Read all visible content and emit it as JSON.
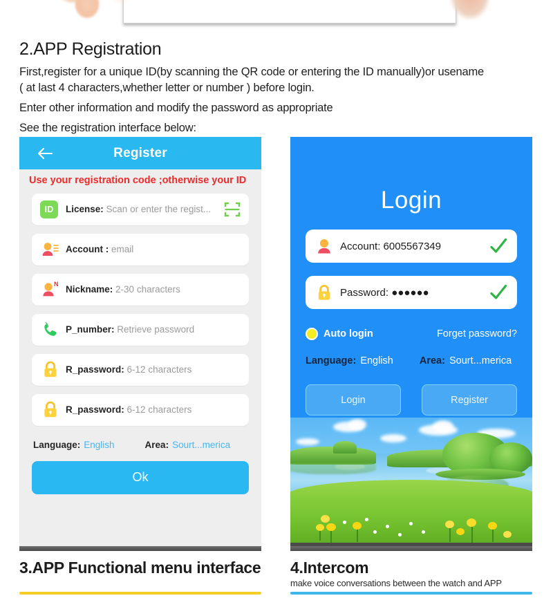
{
  "section": {
    "heading": "2.APP Registration",
    "paragraphs": [
      "First,register for a unique ID(by scanning the QR code or entering the ID manually)or usename",
      "( at last 4 characters,whether letter or number ) before login.",
      "Enter other information and modify the password as appropriate",
      "See the registration interface below:"
    ]
  },
  "register": {
    "back_icon": "back-arrow-icon",
    "title": "Register",
    "warning": "Use your registration code ;otherwise your ID",
    "fields": [
      {
        "icon": "id-badge-icon",
        "icon_text": "ID",
        "label": "License:",
        "value": "Scan or enter the regist...",
        "trailing_icon": "qr-scan-icon"
      },
      {
        "icon": "user-account-icon",
        "icon_text": "",
        "label": "Account :",
        "value": "email",
        "trailing_icon": ""
      },
      {
        "icon": "nickname-user-icon",
        "icon_text": "N",
        "label": "Nickname:",
        "value": "2-30 characters",
        "trailing_icon": ""
      },
      {
        "icon": "phone-icon",
        "icon_text": "",
        "label": "P_number:",
        "value": "Retrieve password",
        "trailing_icon": ""
      },
      {
        "icon": "lock-icon",
        "icon_text": "",
        "label": "R_password:",
        "value": "6-12 characters",
        "trailing_icon": ""
      },
      {
        "icon": "lock-icon",
        "icon_text": "",
        "label": "R_password:",
        "value": "6-12 characters",
        "trailing_icon": ""
      }
    ],
    "language_label": "Language:",
    "language_value": "English",
    "area_label": "Area:",
    "area_value": "Sourt...merica",
    "ok_button": "Ok"
  },
  "login": {
    "title": "Login",
    "fields": [
      {
        "icon": "user-account-icon",
        "label": "Account:",
        "value": "6005567349",
        "check_icon": "green-check-icon"
      },
      {
        "icon": "lock-icon",
        "label": "Password:",
        "value": "●●●●●●",
        "check_icon": "green-check-icon"
      }
    ],
    "auto_login_label": "Auto login",
    "forget_password": "Forget password?",
    "language_label": "Language:",
    "language_value": "English",
    "area_label": "Area:",
    "area_value": "Sourt...merica",
    "login_button": "Login",
    "register_button": "Register"
  },
  "bottom": {
    "left_heading": "3.APP Functional menu interface",
    "right_heading": "4.Intercom",
    "right_sub": "make voice conversations between the watch and APP"
  },
  "colors": {
    "register_header_blue": "#29b8ef",
    "login_blue": "#2090f8",
    "warning_red": "#ee2b2b",
    "ok_button_blue": "#2ab8f2",
    "link_blue": "#46b6f0",
    "rule_yellow": "#f5cf28",
    "rule_blue": "#3fb7ea",
    "id_badge_green": "#7ed957",
    "check_green": "#2fb344"
  }
}
